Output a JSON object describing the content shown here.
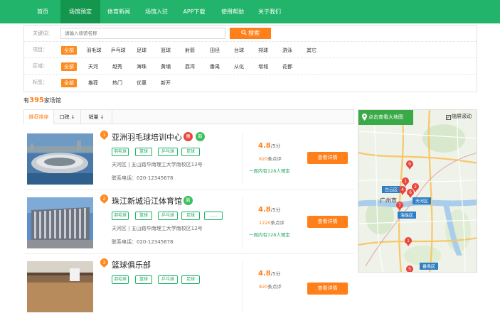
{
  "nav": [
    "首页",
    "场馆预定",
    "体育新闻",
    "场馆入驻",
    "APP下载",
    "使用帮助",
    "关于我们"
  ],
  "filters": {
    "keyword_label": "关键词：",
    "keyword_placeholder": "请输入场馆名称",
    "search_label": "搜索",
    "project_label": "项目：",
    "projects": [
      "全部",
      "羽毛球",
      "乒乓球",
      "足球",
      "篮球",
      "射箭",
      "田径",
      "台球",
      "排球",
      "游泳",
      "其它"
    ],
    "area_label": "区域：",
    "areas": [
      "全部",
      "天河",
      "越秀",
      "海珠",
      "黄埔",
      "荔湾",
      "番禺",
      "从化",
      "增城",
      "花都"
    ],
    "tag_label": "标签：",
    "tags": [
      "全部",
      "推荐",
      "热门",
      "优惠",
      "新开"
    ]
  },
  "count": {
    "prefix": "有",
    "num": "395",
    "suffix": "家场馆"
  },
  "sort": [
    "推荐排序",
    "口碑 ↓",
    "销量 ↓"
  ],
  "venues": [
    {
      "rank": "1",
      "name": "亚洲羽毛球培训中心",
      "badges": [
        {
          "text": "惠",
          "color": "red"
        },
        {
          "text": "新",
          "color": "green"
        }
      ],
      "tags": [
        "羽毛球",
        "篮球",
        "乒乓球",
        "足球"
      ],
      "address": "天河区 | 五山路华南理工大学南校区12号",
      "phone": "联系电话：020-12345678",
      "score": "4.8",
      "score_of": "/5分",
      "reviews_num": "820",
      "reviews_suffix": "条点评",
      "booked": "一周内有128人预定",
      "detail": "查看详情"
    },
    {
      "rank": "2",
      "name": "珠江新城沿江体育馆",
      "badges": [
        {
          "text": "新",
          "color": "green"
        }
      ],
      "tags": [
        "羽毛球",
        "篮球",
        "乒乓球",
        "足球",
        "……"
      ],
      "address": "天河区 | 五山路华南理工大学南校区12号",
      "phone": "联系电话：020-12345678",
      "score": "4.8",
      "score_of": "/5分",
      "reviews_num": "1220",
      "reviews_suffix": "条点评",
      "booked": "一周内有128人预定",
      "detail": "查看详情"
    },
    {
      "rank": "3",
      "name": "篮球俱乐部",
      "badges": [],
      "tags": [
        "羽毛球",
        "篮球",
        "乒乓球",
        "足球"
      ],
      "address": "",
      "phone": "",
      "score": "4.8",
      "score_of": "/5分",
      "reviews_num": "820",
      "reviews_suffix": "条点评",
      "booked": "",
      "detail": "查看详情"
    }
  ],
  "map": {
    "button_label": "点击查看大地图",
    "scroll_label": "随屏滚动",
    "scroll_checked": "✓",
    "labels": [
      "白云区",
      "广州市",
      "天河区",
      "海珠区",
      "番禺区"
    ],
    "markers": [
      "9",
      "1",
      "2",
      "4",
      "6",
      "7",
      "1",
      "5"
    ]
  },
  "colors": {
    "brand_green": "#21b46a",
    "accent_orange": "#ff7f1a",
    "badge_red": "#e8453c"
  }
}
